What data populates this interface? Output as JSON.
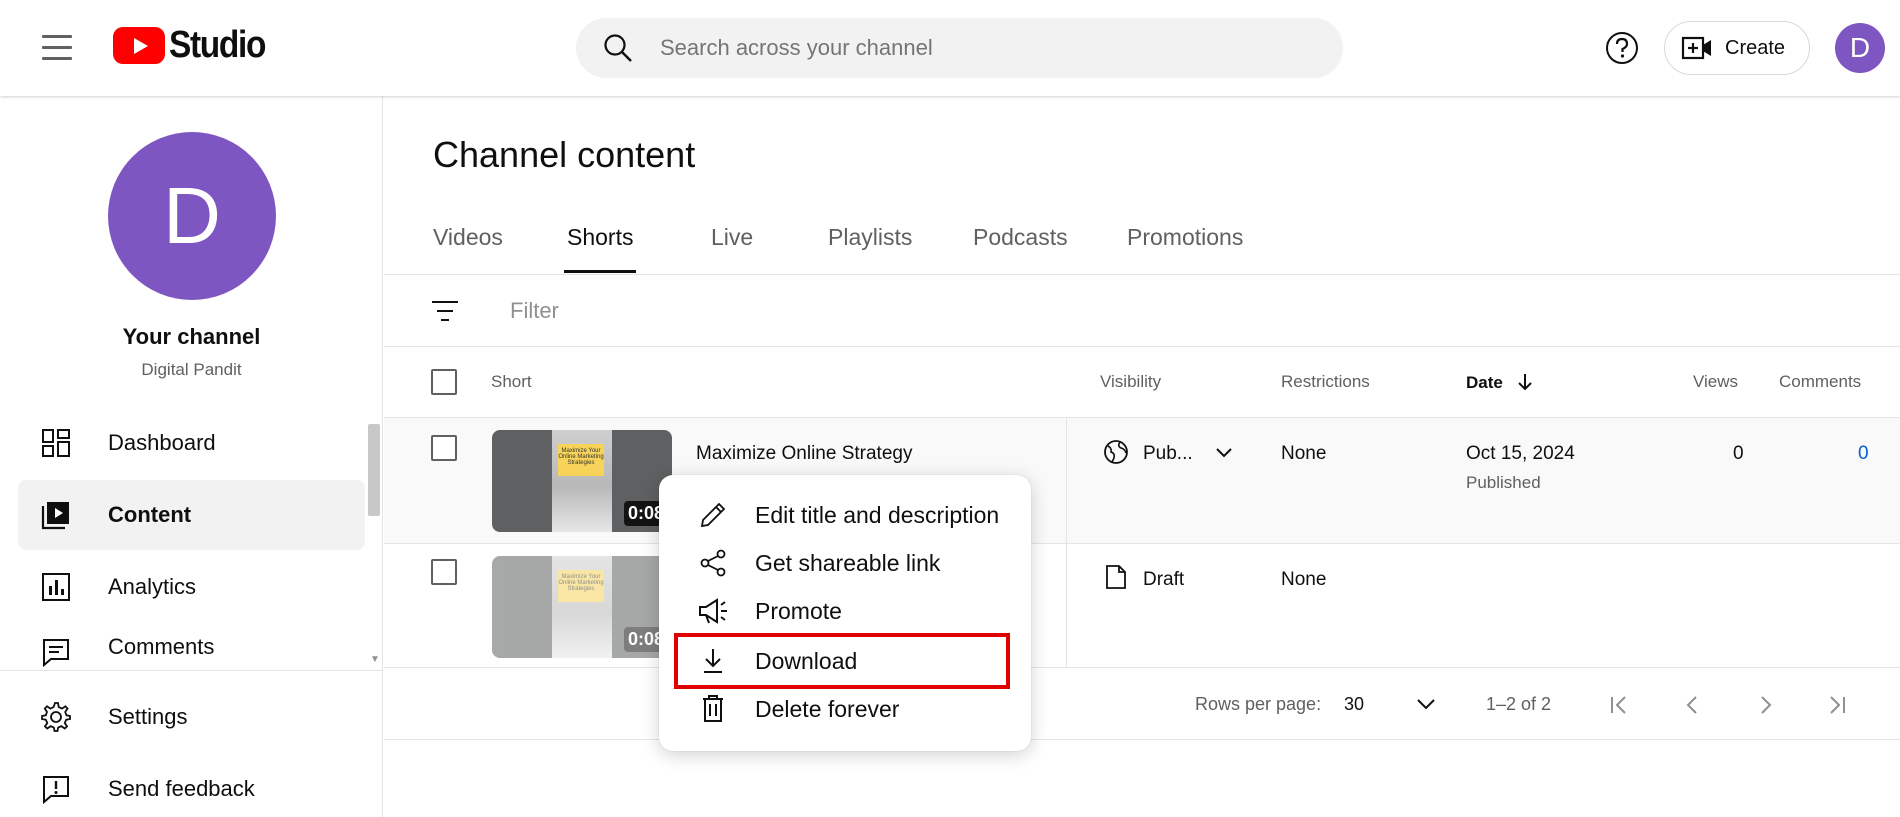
{
  "header": {
    "logo_text": "Studio",
    "search_placeholder": "Search across your channel",
    "create_label": "Create",
    "avatar_letter": "D"
  },
  "sidebar": {
    "avatar_letter": "D",
    "channel_title": "Your channel",
    "channel_name": "Digital Pandit",
    "items": [
      {
        "label": "Dashboard"
      },
      {
        "label": "Content"
      },
      {
        "label": "Analytics"
      },
      {
        "label": "Comments"
      },
      {
        "label": "Settings"
      },
      {
        "label": "Send feedback"
      }
    ]
  },
  "main": {
    "title": "Channel content",
    "tabs": [
      "Videos",
      "Shorts",
      "Live",
      "Playlists",
      "Podcasts",
      "Promotions"
    ],
    "active_tab": "Shorts",
    "filter_placeholder": "Filter",
    "columns": {
      "short": "Short",
      "visibility": "Visibility",
      "restrictions": "Restrictions",
      "date": "Date",
      "views": "Views",
      "comments": "Comments"
    },
    "rows": [
      {
        "title": "Maximize Online Strategy",
        "duration": "0:08",
        "thumb_text": "Maximize Your Online Marketing Strategies",
        "visibility": "Pub...",
        "restrictions": "None",
        "date": "Oct 15, 2024",
        "status": "Published",
        "views": "0",
        "comments": "0"
      },
      {
        "title": "",
        "duration": "0:08",
        "thumb_text": "Maximize Your Online Marketing Strategies",
        "visibility": "Draft",
        "restrictions": "None",
        "date": "",
        "status": "",
        "views": "",
        "comments": ""
      }
    ],
    "pagination": {
      "rows_per_page_label": "Rows per page:",
      "rows_per_page": "30",
      "range": "1–2 of 2"
    }
  },
  "menu": {
    "items": [
      {
        "label": "Edit title and description",
        "icon": "pencil-icon"
      },
      {
        "label": "Get shareable link",
        "icon": "share-icon"
      },
      {
        "label": "Promote",
        "icon": "megaphone-icon"
      },
      {
        "label": "Download",
        "icon": "download-icon"
      },
      {
        "label": "Delete forever",
        "icon": "trash-icon"
      }
    ],
    "highlighted": "Download"
  },
  "colors": {
    "accent_purple": "#7e56c2",
    "youtube_red": "#ff0000",
    "highlight_red": "#e00000",
    "link_blue": "#065fd4"
  }
}
